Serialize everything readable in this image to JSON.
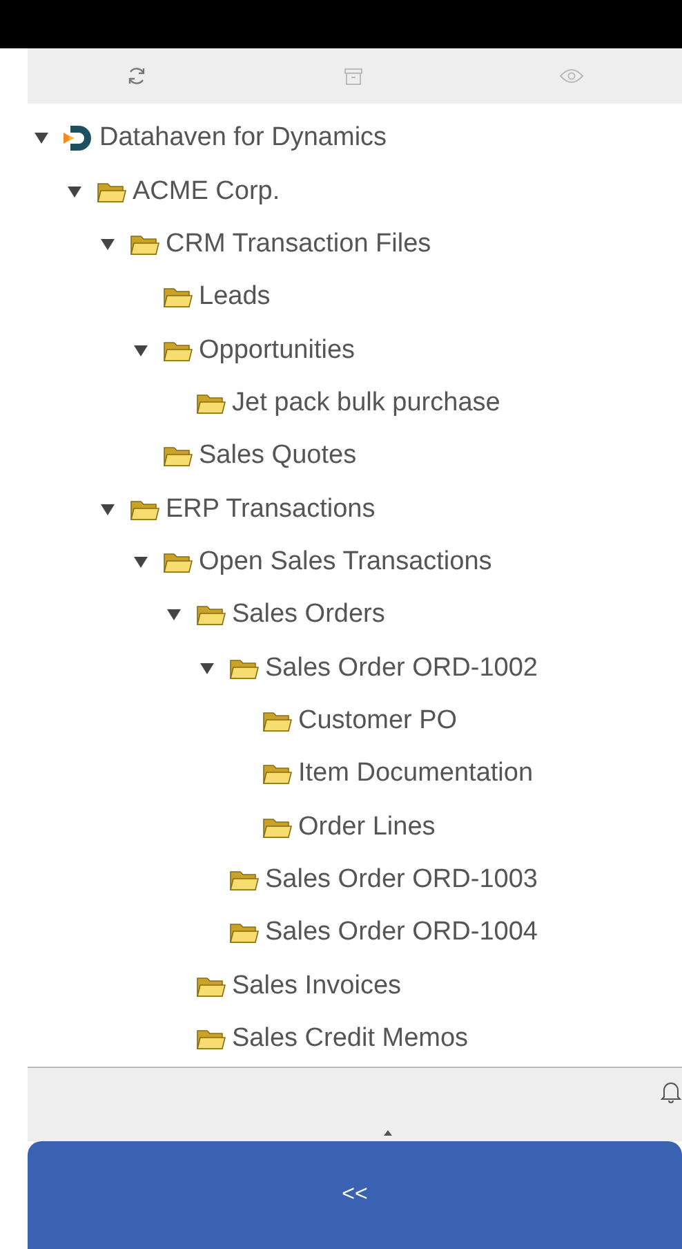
{
  "tree": [
    {
      "label": "Datahaven for Dynamics",
      "kind": "logo",
      "expanded": true,
      "children": [
        {
          "label": "ACME Corp.",
          "kind": "folder",
          "expanded": true,
          "children": [
            {
              "label": "CRM Transaction Files",
              "kind": "folder",
              "expanded": true,
              "children": [
                {
                  "label": "Leads",
                  "kind": "folder"
                },
                {
                  "label": "Opportunities",
                  "kind": "folder",
                  "expanded": true,
                  "children": [
                    {
                      "label": "Jet pack bulk purchase",
                      "kind": "folder"
                    }
                  ]
                },
                {
                  "label": "Sales Quotes",
                  "kind": "folder"
                }
              ]
            },
            {
              "label": "ERP Transactions",
              "kind": "folder",
              "expanded": true,
              "children": [
                {
                  "label": "Open Sales Transactions",
                  "kind": "folder",
                  "expanded": true,
                  "children": [
                    {
                      "label": "Sales Orders",
                      "kind": "folder",
                      "expanded": true,
                      "children": [
                        {
                          "label": "Sales Order ORD-1002",
                          "kind": "folder",
                          "expanded": true,
                          "children": [
                            {
                              "label": "Customer PO",
                              "kind": "folder"
                            },
                            {
                              "label": "Item Documentation",
                              "kind": "folder"
                            },
                            {
                              "label": "Order Lines",
                              "kind": "folder"
                            }
                          ]
                        },
                        {
                          "label": "Sales Order ORD-1003",
                          "kind": "folder"
                        },
                        {
                          "label": "Sales Order ORD-1004",
                          "kind": "folder"
                        }
                      ]
                    },
                    {
                      "label": "Sales Invoices",
                      "kind": "folder"
                    },
                    {
                      "label": "Sales Credit Memos",
                      "kind": "folder"
                    }
                  ]
                }
              ]
            }
          ]
        }
      ]
    }
  ],
  "collapse_button": {
    "label": "<<"
  }
}
